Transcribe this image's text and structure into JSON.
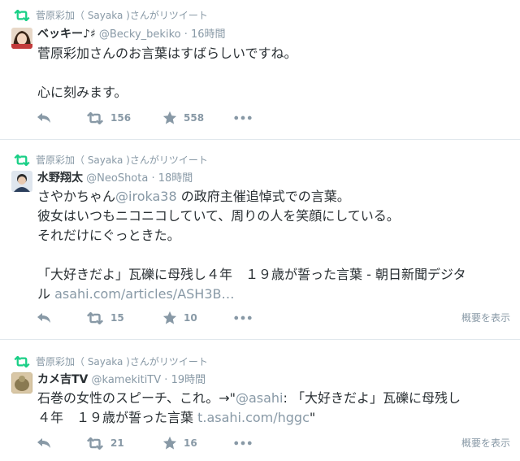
{
  "tweets": [
    {
      "retweet_text": "菅原彩加（ Sayaka )さんがリツイート",
      "name": "ベッキー♪♯",
      "screen_name": "@Becky_bekiko",
      "dot": "·",
      "time": "16時間",
      "lines": [
        "菅原彩加さんのお言葉はすばらしいですね。",
        "",
        "心に刻みます。"
      ],
      "retweets": "156",
      "favorites": "558",
      "expand": ""
    },
    {
      "retweet_text": "菅原彩加（ Sayaka )さんがリツイート",
      "name": "水野翔太",
      "screen_name": "@NeoShota",
      "dot": "·",
      "time": "18時間",
      "line1_pre": "さやかちゃん",
      "line1_mention": "@iroka38",
      "line1_post": " の政府主催追悼式での言葉。",
      "line2": "彼女はいつもニコニコしていて、周りの人を笑顔にしている。",
      "line3": "それだけにぐっときた。",
      "line5": "「大好きだよ」瓦礫に母残し４年　１９歳が誓った言葉 - 朝日新聞デジタ",
      "line6_pre": "ル ",
      "line6_link": "asahi.com/articles/ASH3B…",
      "retweets": "15",
      "favorites": "10",
      "expand": "概要を表示"
    },
    {
      "retweet_text": "菅原彩加（ Sayaka )さんがリツイート",
      "name": "カメ吉TV",
      "screen_name": "@kamekitiTV",
      "dot": "·",
      "time": "19時間",
      "line1_pre": "石巻の女性のスピーチ、これ。→\"",
      "line1_mention": "@asahi",
      "line1_post": ": 「大好きだよ」瓦礫に母残し",
      "line2_pre": "４年　１９歳が誓った言葉 ",
      "line2_link": "t.asahi.com/hggc",
      "line2_post": "\"",
      "retweets": "21",
      "favorites": "16",
      "expand": "概要を表示"
    }
  ],
  "icons": {
    "retweet_banner": "retweet-icon",
    "reply": "reply-icon",
    "retweet": "retweet-icon",
    "favorite": "star-icon",
    "more": "more-icon"
  },
  "colors": {
    "retweet_green": "#19cf86",
    "muted": "#8899a6",
    "text": "#292f33"
  }
}
